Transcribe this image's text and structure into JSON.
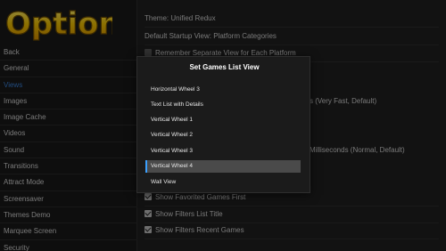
{
  "app": {
    "logo_text": "Options"
  },
  "sidebar": {
    "items": [
      {
        "label": "Back",
        "active": false
      },
      {
        "label": "General",
        "active": false
      },
      {
        "label": "Views",
        "active": true
      },
      {
        "label": "Images",
        "active": false
      },
      {
        "label": "Image Cache",
        "active": false
      },
      {
        "label": "Videos",
        "active": false
      },
      {
        "label": "Sound",
        "active": false
      },
      {
        "label": "Transitions",
        "active": false
      },
      {
        "label": "Attract Mode",
        "active": false
      },
      {
        "label": "Screensaver",
        "active": false
      },
      {
        "label": "Themes Demo",
        "active": false
      },
      {
        "label": "Marquee Screen",
        "active": false
      },
      {
        "label": "Security",
        "active": false
      }
    ]
  },
  "settings": {
    "theme": "Theme: Unified Redux",
    "startup_view": "Default Startup View: Platform Categories",
    "remember_view": {
      "label": "Remember Separate View for Each Platform",
      "checked": false
    },
    "partial_speed": "s (Very Fast, Default)",
    "partial_delay": "Milliseconds (Normal, Default)",
    "show_favorites": {
      "label": "Show Favorited Games First",
      "checked": true
    },
    "show_filters_title": {
      "label": "Show Filters List Title",
      "checked": true
    },
    "show_filters_recent": {
      "label": "Show Filters Recent Games",
      "checked": true
    }
  },
  "modal": {
    "title": "Set Games List View",
    "options": [
      {
        "label": "Horizontal Wheel 3",
        "selected": false
      },
      {
        "label": "Text List with Details",
        "selected": false
      },
      {
        "label": "Vertical Wheel 1",
        "selected": false
      },
      {
        "label": "Vertical Wheel 2",
        "selected": false
      },
      {
        "label": "Vertical Wheel 3",
        "selected": false
      },
      {
        "label": "Vertical Wheel 4",
        "selected": true
      },
      {
        "label": "Wall View",
        "selected": false
      }
    ]
  },
  "colors": {
    "accent": "#3b82d9",
    "selection_bar": "#3ba0ff",
    "logo_fill": "#f2c200"
  }
}
